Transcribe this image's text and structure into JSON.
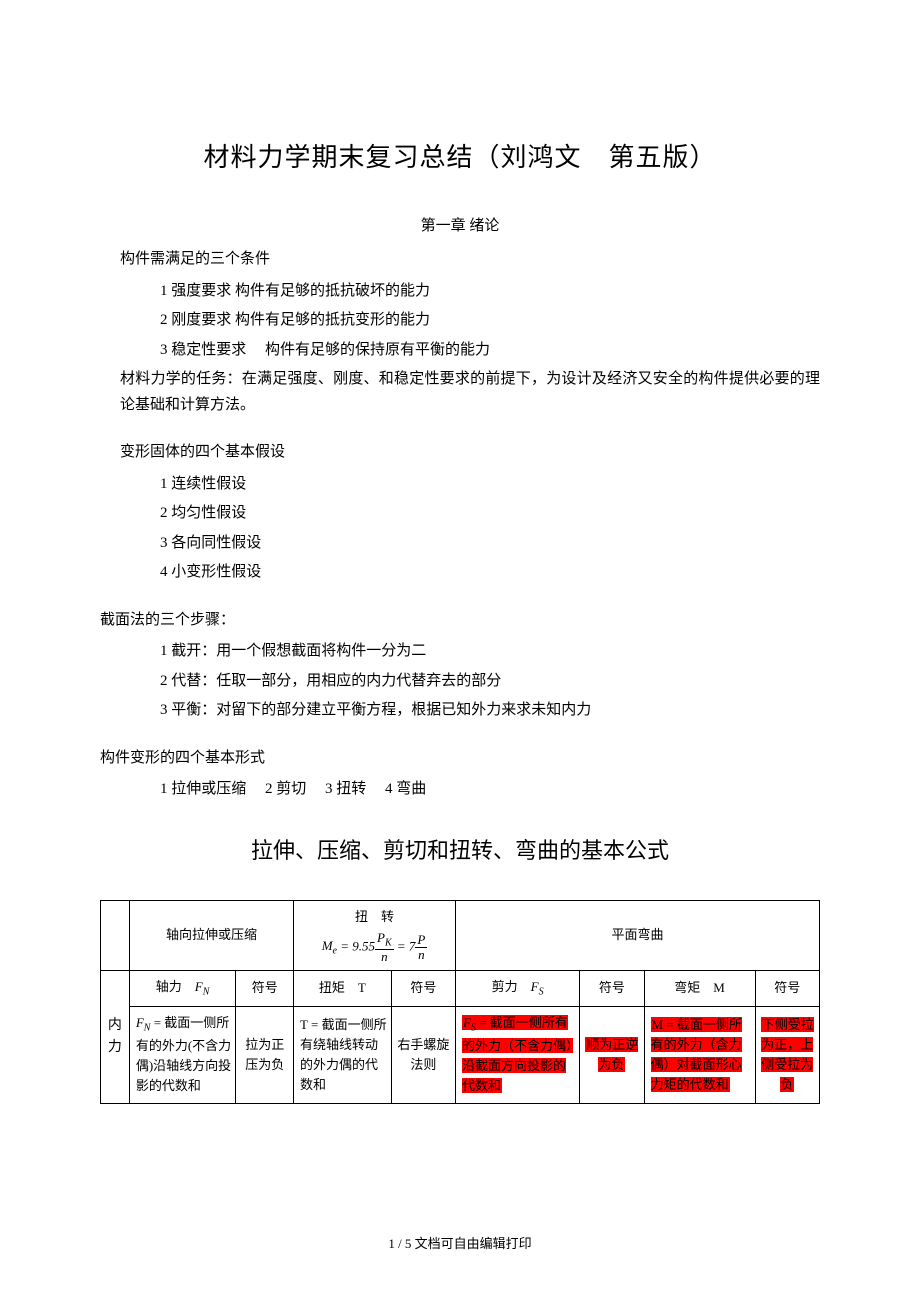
{
  "doc": {
    "title": "材料力学期末复习总结（刘鸿文　第五版）",
    "chapter": "第一章 绪论",
    "conditions": {
      "label": "构件需满足的三个条件",
      "items": [
        "1 强度要求 构件有足够的抵抗破坏的能力",
        "2 刚度要求 构件有足够的抵抗变形的能力",
        "3 稳定性要求 　构件有足够的保持原有平衡的能力"
      ]
    },
    "task": "材料力学的任务：在满足强度、刚度、和稳定性要求的前提下，为设计及经济又安全的构件提供必要的理论基础和计算方法。",
    "assumptions": {
      "label": "变形固体的四个基本假设",
      "items": [
        "1 连续性假设",
        "2 均匀性假设",
        "3 各向同性假设",
        "4 小变形性假设"
      ]
    },
    "section_method": {
      "label": "截面法的三个步骤：",
      "items": [
        "1 截开：用一个假想截面将构件一分为二",
        "2 代替：任取一部分，用相应的内力代替弃去的部分",
        "3 平衡：对留下的部分建立平衡方程，根据已知外力来求未知内力"
      ]
    },
    "forms": {
      "label": "构件变形的四个基本形式",
      "line": "1 拉伸或压缩　  2 剪切　  3 扭转　  4 弯曲"
    },
    "subtitle": "拉伸、压缩、剪切和扭转、弯曲的基本公式",
    "table": {
      "header": {
        "col1": "轴向拉伸或压缩",
        "col2_label": "扭　转",
        "col2_formula_prefix": "M",
        "col2_formula_sub": "e",
        "col2_formula_eq": " = 9.55",
        "col2_formula_pk": "P",
        "col2_formula_pk_sub": "K",
        "col2_formula_n": "n",
        "col2_formula_eq2": " = 7",
        "col2_formula_p": "P",
        "col3": "平面弯曲"
      },
      "row1": {
        "c1": "轴力　",
        "c1_sym": "F",
        "c1_sub": "N",
        "c2": "符号",
        "c3": "扭矩　T",
        "c4": "符号",
        "c5": "剪力　",
        "c5_sym": "F",
        "c5_sub": "S",
        "c6": "符号",
        "c7": "弯矩　M",
        "c8": "符号"
      },
      "row2": {
        "side": "内力",
        "c1_sym": "F",
        "c1_sub": "N",
        "c1_text": " = 截面一侧所有的外力(不含力偶)沿轴线方向投影的代数和",
        "c2": "拉为正压为负",
        "c3": "T = 截面一侧所有绕轴线转动的外力偶的代数和",
        "c4": "右手螺旋法则",
        "c5_sym": "F",
        "c5_sub": "S",
        "c5_text": " = 截面一侧所有的外力（不含力偶）沿截面方向投影的代数和",
        "c6": "顺为正逆为负",
        "c7": "M = 截面一侧所有的外力（含力偶）对截面形心力矩的代数和",
        "c8": "下侧受拉为正，上侧受拉为负"
      }
    },
    "footer": "1 / 5 文档可自由编辑打印"
  }
}
